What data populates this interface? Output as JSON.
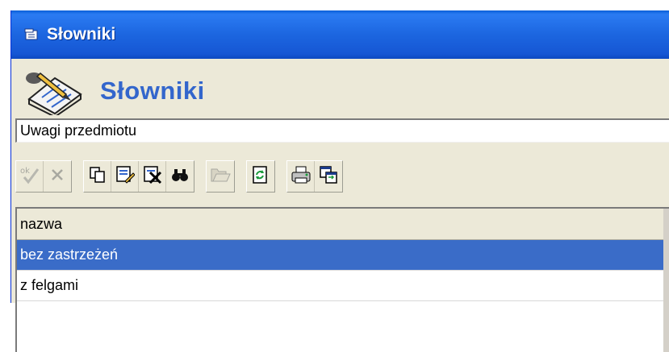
{
  "window": {
    "title": "Słowniki"
  },
  "header": {
    "title": "Słowniki",
    "icon": "notebook-pen-icon"
  },
  "dictionary_select": {
    "value": "Uwagi przedmiotu"
  },
  "toolbar": {
    "groups": [
      [
        {
          "name": "ok-button",
          "icon": "ok-check-icon",
          "enabled": false
        },
        {
          "name": "cancel-button",
          "icon": "x-icon",
          "enabled": false
        }
      ],
      [
        {
          "name": "copy-button",
          "icon": "copy-icon",
          "enabled": true
        },
        {
          "name": "edit-button",
          "icon": "edit-pencil-icon",
          "enabled": true
        },
        {
          "name": "delete-button",
          "icon": "delete-x-icon",
          "enabled": true
        },
        {
          "name": "find-button",
          "icon": "binoculars-icon",
          "enabled": true
        }
      ],
      [
        {
          "name": "open-button",
          "icon": "folder-open-icon",
          "enabled": false
        }
      ],
      [
        {
          "name": "refresh-button",
          "icon": "refresh-icon",
          "enabled": true
        }
      ],
      [
        {
          "name": "print-button",
          "icon": "printer-icon",
          "enabled": true
        },
        {
          "name": "export-button",
          "icon": "export-window-icon",
          "enabled": true
        }
      ]
    ]
  },
  "grid": {
    "column": "nazwa",
    "rows": [
      "bez zastrzeżeń",
      "z felgami"
    ],
    "selected_index": 0
  },
  "colors": {
    "titlebar": "#1c66e0",
    "header_title": "#3366cc",
    "selection": "#3a6cc8"
  }
}
